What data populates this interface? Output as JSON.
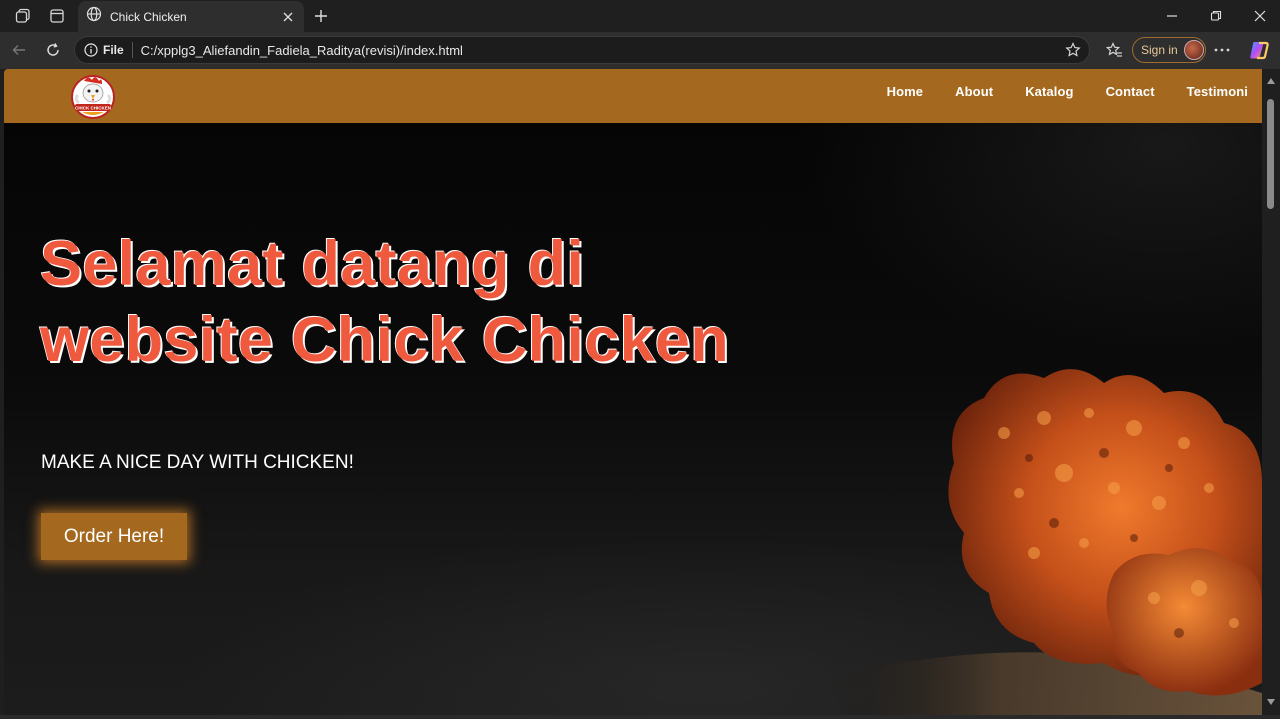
{
  "browser": {
    "tab_title": "Chick Chicken",
    "file_label": "File",
    "url": "C:/xpplg3_Aliefandin_Fadiela_Raditya(revisi)/index.html",
    "signin_label": "Sign in",
    "accent": "#a06b2c"
  },
  "site": {
    "logo_text": "CHICK CHICKEN",
    "nav": [
      "Home",
      "About",
      "Katalog",
      "Contact",
      "Testimoni"
    ],
    "hero": {
      "headline_line1": "Selamat datang di",
      "headline_line2": "website Chick Chicken",
      "tagline": "MAKE A NICE DAY WITH CHICKEN!",
      "cta": "Order Here!"
    },
    "colors": {
      "brand": "#a4691e",
      "headline": "#ef5a3f",
      "background": "#0a0a0a"
    }
  }
}
